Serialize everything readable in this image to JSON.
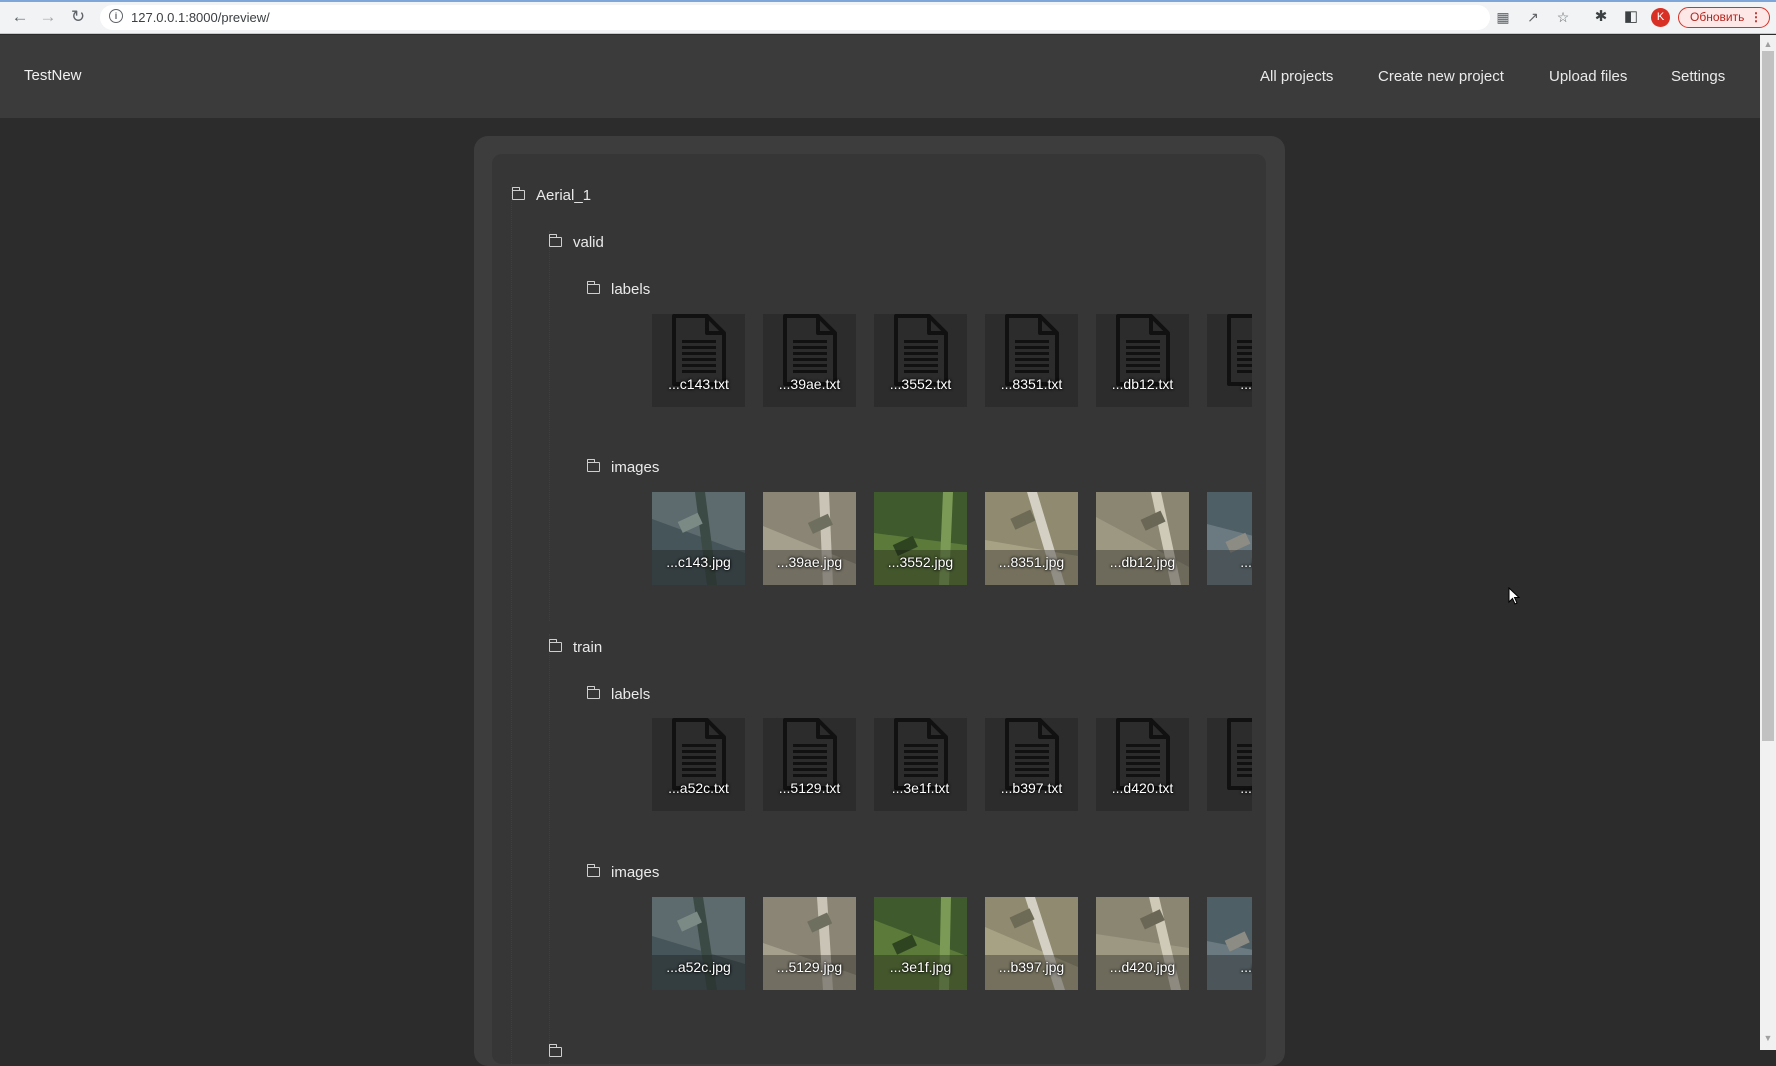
{
  "browser": {
    "url": "127.0.0.1:8000/preview/",
    "profile_initial": "K",
    "update_label": "Обновить",
    "icons": [
      "back-icon",
      "forward-icon",
      "reload-icon",
      "info-icon",
      "translate-icon",
      "share-icon",
      "star-icon",
      "extensions-icon",
      "sidepanel-icon",
      "menu-icon"
    ]
  },
  "header": {
    "brand": "TestNew",
    "nav": [
      "All projects",
      "Create new project",
      "Upload files",
      "Settings"
    ]
  },
  "tree": {
    "root": "Aerial_1",
    "valid": {
      "name": "valid",
      "labels": {
        "name": "labels",
        "files": [
          "...c143.txt",
          "...39ae.txt",
          "...3552.txt",
          "...8351.txt",
          "...db12.txt",
          "...ac"
        ]
      },
      "images": {
        "name": "images",
        "files": [
          "...c143.jpg",
          "...39ae.jpg",
          "...3552.jpg",
          "...8351.jpg",
          "...db12.jpg",
          "...ac"
        ]
      }
    },
    "train": {
      "name": "train",
      "labels": {
        "name": "labels",
        "files": [
          "...a52c.txt",
          "...5129.txt",
          "...3e1f.txt",
          "...b397.txt",
          "...d420.txt",
          "...ac"
        ]
      },
      "images": {
        "name": "images",
        "files": [
          "...a52c.jpg",
          "...5129.jpg",
          "...3e1f.jpg",
          "...b397.jpg",
          "...d420.jpg",
          "...ac"
        ]
      }
    }
  },
  "colors": {
    "page_bg": "#2c2c2c",
    "header_bg": "#3b3b3b",
    "panel_outer": "#3d3d3d",
    "panel_inner": "#363636",
    "tile_bg": "#2c2c2c"
  }
}
